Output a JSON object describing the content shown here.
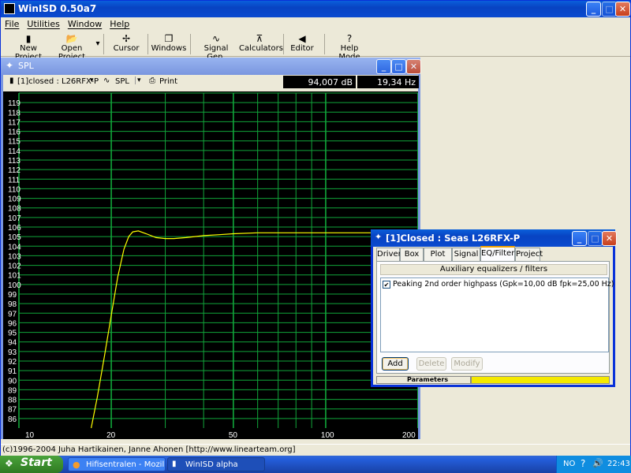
{
  "main": {
    "title": "WinISD 0.50a7",
    "menu": [
      "File",
      "Utilities",
      "Window",
      "Help"
    ],
    "toolbar": [
      {
        "label": "New Project",
        "icon": "new-project-icon"
      },
      {
        "label": "Open Project",
        "icon": "open-project-icon"
      },
      {
        "label": "Cursor",
        "icon": "cursor-icon"
      },
      {
        "label": "Windows",
        "icon": "windows-icon"
      },
      {
        "label": "Signal Gen.",
        "icon": "signal-gen-icon"
      },
      {
        "label": "Calculators",
        "icon": "calculators-icon"
      },
      {
        "label": "Editor",
        "icon": "editor-icon"
      },
      {
        "label": "Help Mode",
        "icon": "help-mode-icon"
      }
    ],
    "status": "(c)1996-2004 Juha Hartikainen, Janne Ahonen [http://www.linearteam.org]"
  },
  "spl": {
    "title": "SPL",
    "project_select": "[1]closed : L26RFX-P",
    "graph_select": "SPL",
    "print_label": "Print",
    "db_readout": "94,007 dB",
    "hz_readout": "19,34 Hz"
  },
  "chart_data": {
    "type": "line",
    "x_scale": "log",
    "xlim": [
      10,
      200
    ],
    "ylim": [
      85,
      120
    ],
    "y_ticks": [
      86,
      87,
      88,
      89,
      90,
      91,
      92,
      93,
      94,
      95,
      96,
      97,
      98,
      99,
      100,
      101,
      102,
      103,
      104,
      105,
      106,
      107,
      108,
      109,
      110,
      111,
      112,
      113,
      114,
      115,
      116,
      117,
      118,
      119
    ],
    "x_tick_labels": [
      10,
      20,
      50,
      100,
      200
    ],
    "grid": true,
    "series": [
      {
        "color": "#ffff00",
        "x": [
          17.2,
          18,
          19,
          20,
          21,
          22,
          22.8,
          23.5,
          24.5,
          26,
          28,
          30,
          32,
          35,
          40,
          45,
          50,
          60,
          70,
          80,
          100,
          120,
          150,
          200
        ],
        "y": [
          85,
          88.2,
          92.5,
          96.8,
          100.8,
          103.7,
          105.0,
          105.5,
          105.6,
          105.3,
          104.9,
          104.8,
          104.8,
          104.9,
          105.1,
          105.2,
          105.3,
          105.4,
          105.4,
          105.4,
          105.4,
          105.4,
          105.4,
          105.4
        ]
      }
    ]
  },
  "dialog": {
    "title": "[1]Closed : Seas  L26RFX-P",
    "tabs": [
      "Driver",
      "Box",
      "Plot",
      "Signal",
      "EQ/Filter",
      "Project"
    ],
    "active_tab": "EQ/Filter",
    "section_header": "Auxiliary equalizers / filters",
    "items": [
      {
        "checked": true,
        "label": "Peaking 2nd order highpass (Gpk=10,00 dB fpk=25,00 Hz)"
      }
    ],
    "buttons": {
      "add": "Add",
      "delete": "Delete",
      "modify": "Modify"
    },
    "parameters_label": "Parameters",
    "accent": "#f5e900"
  },
  "taskbar": {
    "start": "Start",
    "tasks": [
      "Hifisentralen - Mozilla ...",
      "WinISD alpha"
    ],
    "lang": "NO",
    "clock": "22:43"
  }
}
